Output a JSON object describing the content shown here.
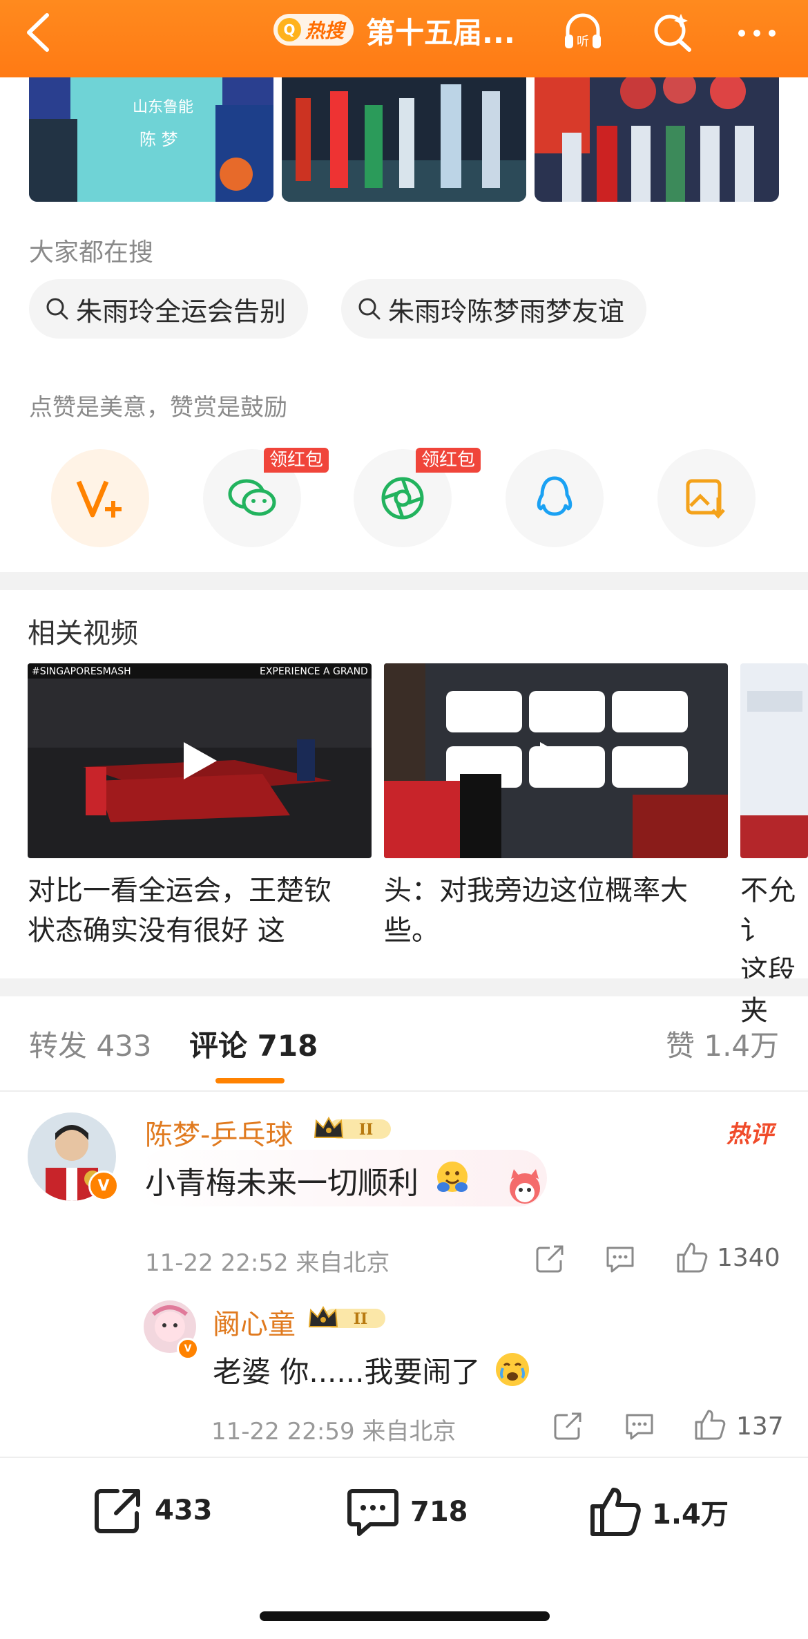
{
  "header": {
    "hot_tag": "热搜",
    "title": "第十五届...",
    "colors": {
      "bar": "#ff7a14",
      "accent": "#ff8200"
    }
  },
  "search": {
    "label": "大家都在搜",
    "chips": [
      "朱雨玲全运会告别",
      "朱雨玲陈梦雨梦友谊"
    ]
  },
  "share": {
    "label": "点赞是美意，赞赏是鼓励",
    "items": [
      {
        "icon": "v-plus-icon",
        "badge": ""
      },
      {
        "icon": "wechat-icon",
        "badge": "领红包"
      },
      {
        "icon": "moments-icon",
        "badge": "领红包"
      },
      {
        "icon": "qq-icon",
        "badge": ""
      },
      {
        "icon": "save-image-icon",
        "badge": ""
      }
    ]
  },
  "related": {
    "label": "相关视频",
    "videos": [
      {
        "title_line1": "对比一看全运会，王楚钦",
        "title_line2": "状态确实没有很好 这"
      },
      {
        "title_line1": "头：对我旁边这位概率大",
        "title_line2": "些。"
      },
      {
        "title_line1": "不允讠",
        "title_line2": "这段夹"
      }
    ]
  },
  "tabs": {
    "repost": "转发 433",
    "comments": "评论 718",
    "likes": "赞 1.4万"
  },
  "comments": [
    {
      "user": "陈梦-乒乓球",
      "level": "II",
      "hot": "热评",
      "text": "小青梅未来一切顺利",
      "time": "11-22 22:52 来自北京",
      "likes": "1340"
    },
    {
      "user": "阚心童",
      "level": "II",
      "text": "老婆 你......我要闹了",
      "time": "11-22 22:59 来自北京",
      "likes": "137"
    }
  ],
  "bottom": {
    "reposts": "433",
    "comments": "718",
    "likes": "1.4万"
  }
}
